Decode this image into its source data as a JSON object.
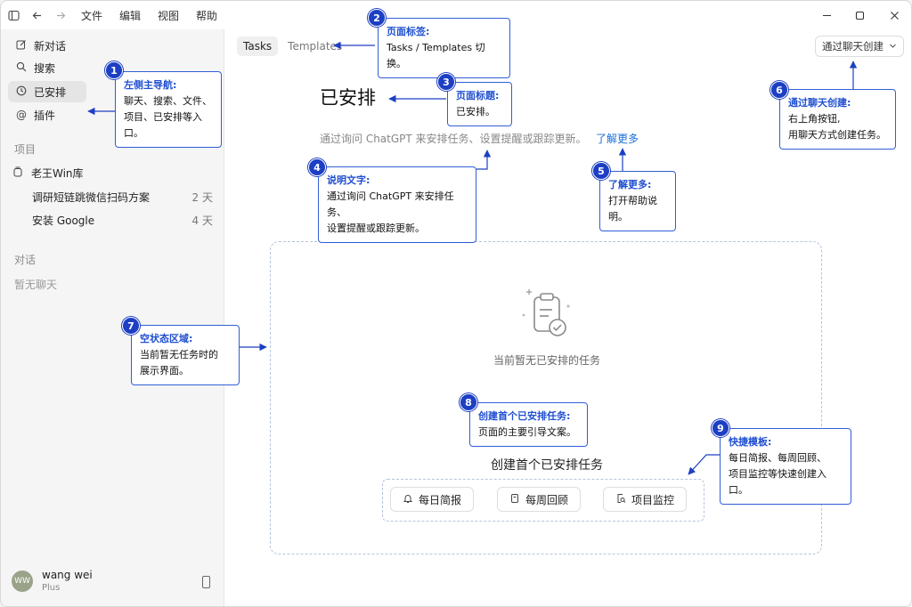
{
  "menu": [
    "文件",
    "编辑",
    "视图",
    "帮助"
  ],
  "sidebar": {
    "nav": [
      {
        "label": "新对话",
        "icon": "edit-icon"
      },
      {
        "label": "搜索",
        "icon": "search-icon"
      },
      {
        "label": "已安排",
        "icon": "clock-icon"
      },
      {
        "label": "插件",
        "icon": "at-icon"
      }
    ],
    "projects_label": "项目",
    "project_name": "老王Win库",
    "tasks": [
      {
        "name": "调研短链跳微信扫码方案",
        "age": "2 天"
      },
      {
        "name": "安装 Google",
        "age": "4 天"
      }
    ],
    "chats_label": "对话",
    "chats_empty": "暂无聊天",
    "user": {
      "initials": "WW",
      "name": "wang wei",
      "plan": "Plus"
    }
  },
  "main": {
    "tabs": [
      "Tasks",
      "Templates"
    ],
    "create_button": "通过聊天创建",
    "title": "已安排",
    "description": "通过询问 ChatGPT 来安排任务、设置提醒或跟踪更新。",
    "learn_more": "了解更多",
    "empty_text": "当前暂无已安排的任务",
    "create_title": "创建首个已安排任务",
    "templates": [
      {
        "label": "每日简报",
        "icon": "bell-icon"
      },
      {
        "label": "每周回顾",
        "icon": "notebook-icon"
      },
      {
        "label": "项目监控",
        "icon": "doc-search-icon"
      }
    ]
  },
  "annotations": [
    {
      "num": "1",
      "title": "左侧主导航:",
      "lines": [
        "聊天、搜索、文件、",
        "项目、已安排等入口。"
      ]
    },
    {
      "num": "2",
      "title": "页面标签:",
      "lines": [
        "Tasks / Templates 切换。"
      ]
    },
    {
      "num": "3",
      "title": "页面标题:",
      "lines": [
        "已安排。"
      ]
    },
    {
      "num": "4",
      "title": "说明文字:",
      "lines": [
        "通过询问 ChatGPT 来安排任务、",
        "设置提醒或跟踪更新。"
      ]
    },
    {
      "num": "5",
      "title": "了解更多:",
      "lines": [
        "打开帮助说明。"
      ]
    },
    {
      "num": "6",
      "title": "通过聊天创建:",
      "lines": [
        "右上角按钮,",
        "用聊天方式创建任务。"
      ]
    },
    {
      "num": "7",
      "title": "空状态区域:",
      "lines": [
        "当前暂无任务时的",
        "展示界面。"
      ]
    },
    {
      "num": "8",
      "title": "创建首个已安排任务:",
      "lines": [
        "页面的主要引导文案。"
      ]
    },
    {
      "num": "9",
      "title": "快捷模板:",
      "lines": [
        "每日简报、每周回顾、",
        "项目监控等快速创建入口。"
      ]
    }
  ],
  "colors": {
    "accent": "#1d3fc4",
    "link": "#1a6fd6"
  }
}
